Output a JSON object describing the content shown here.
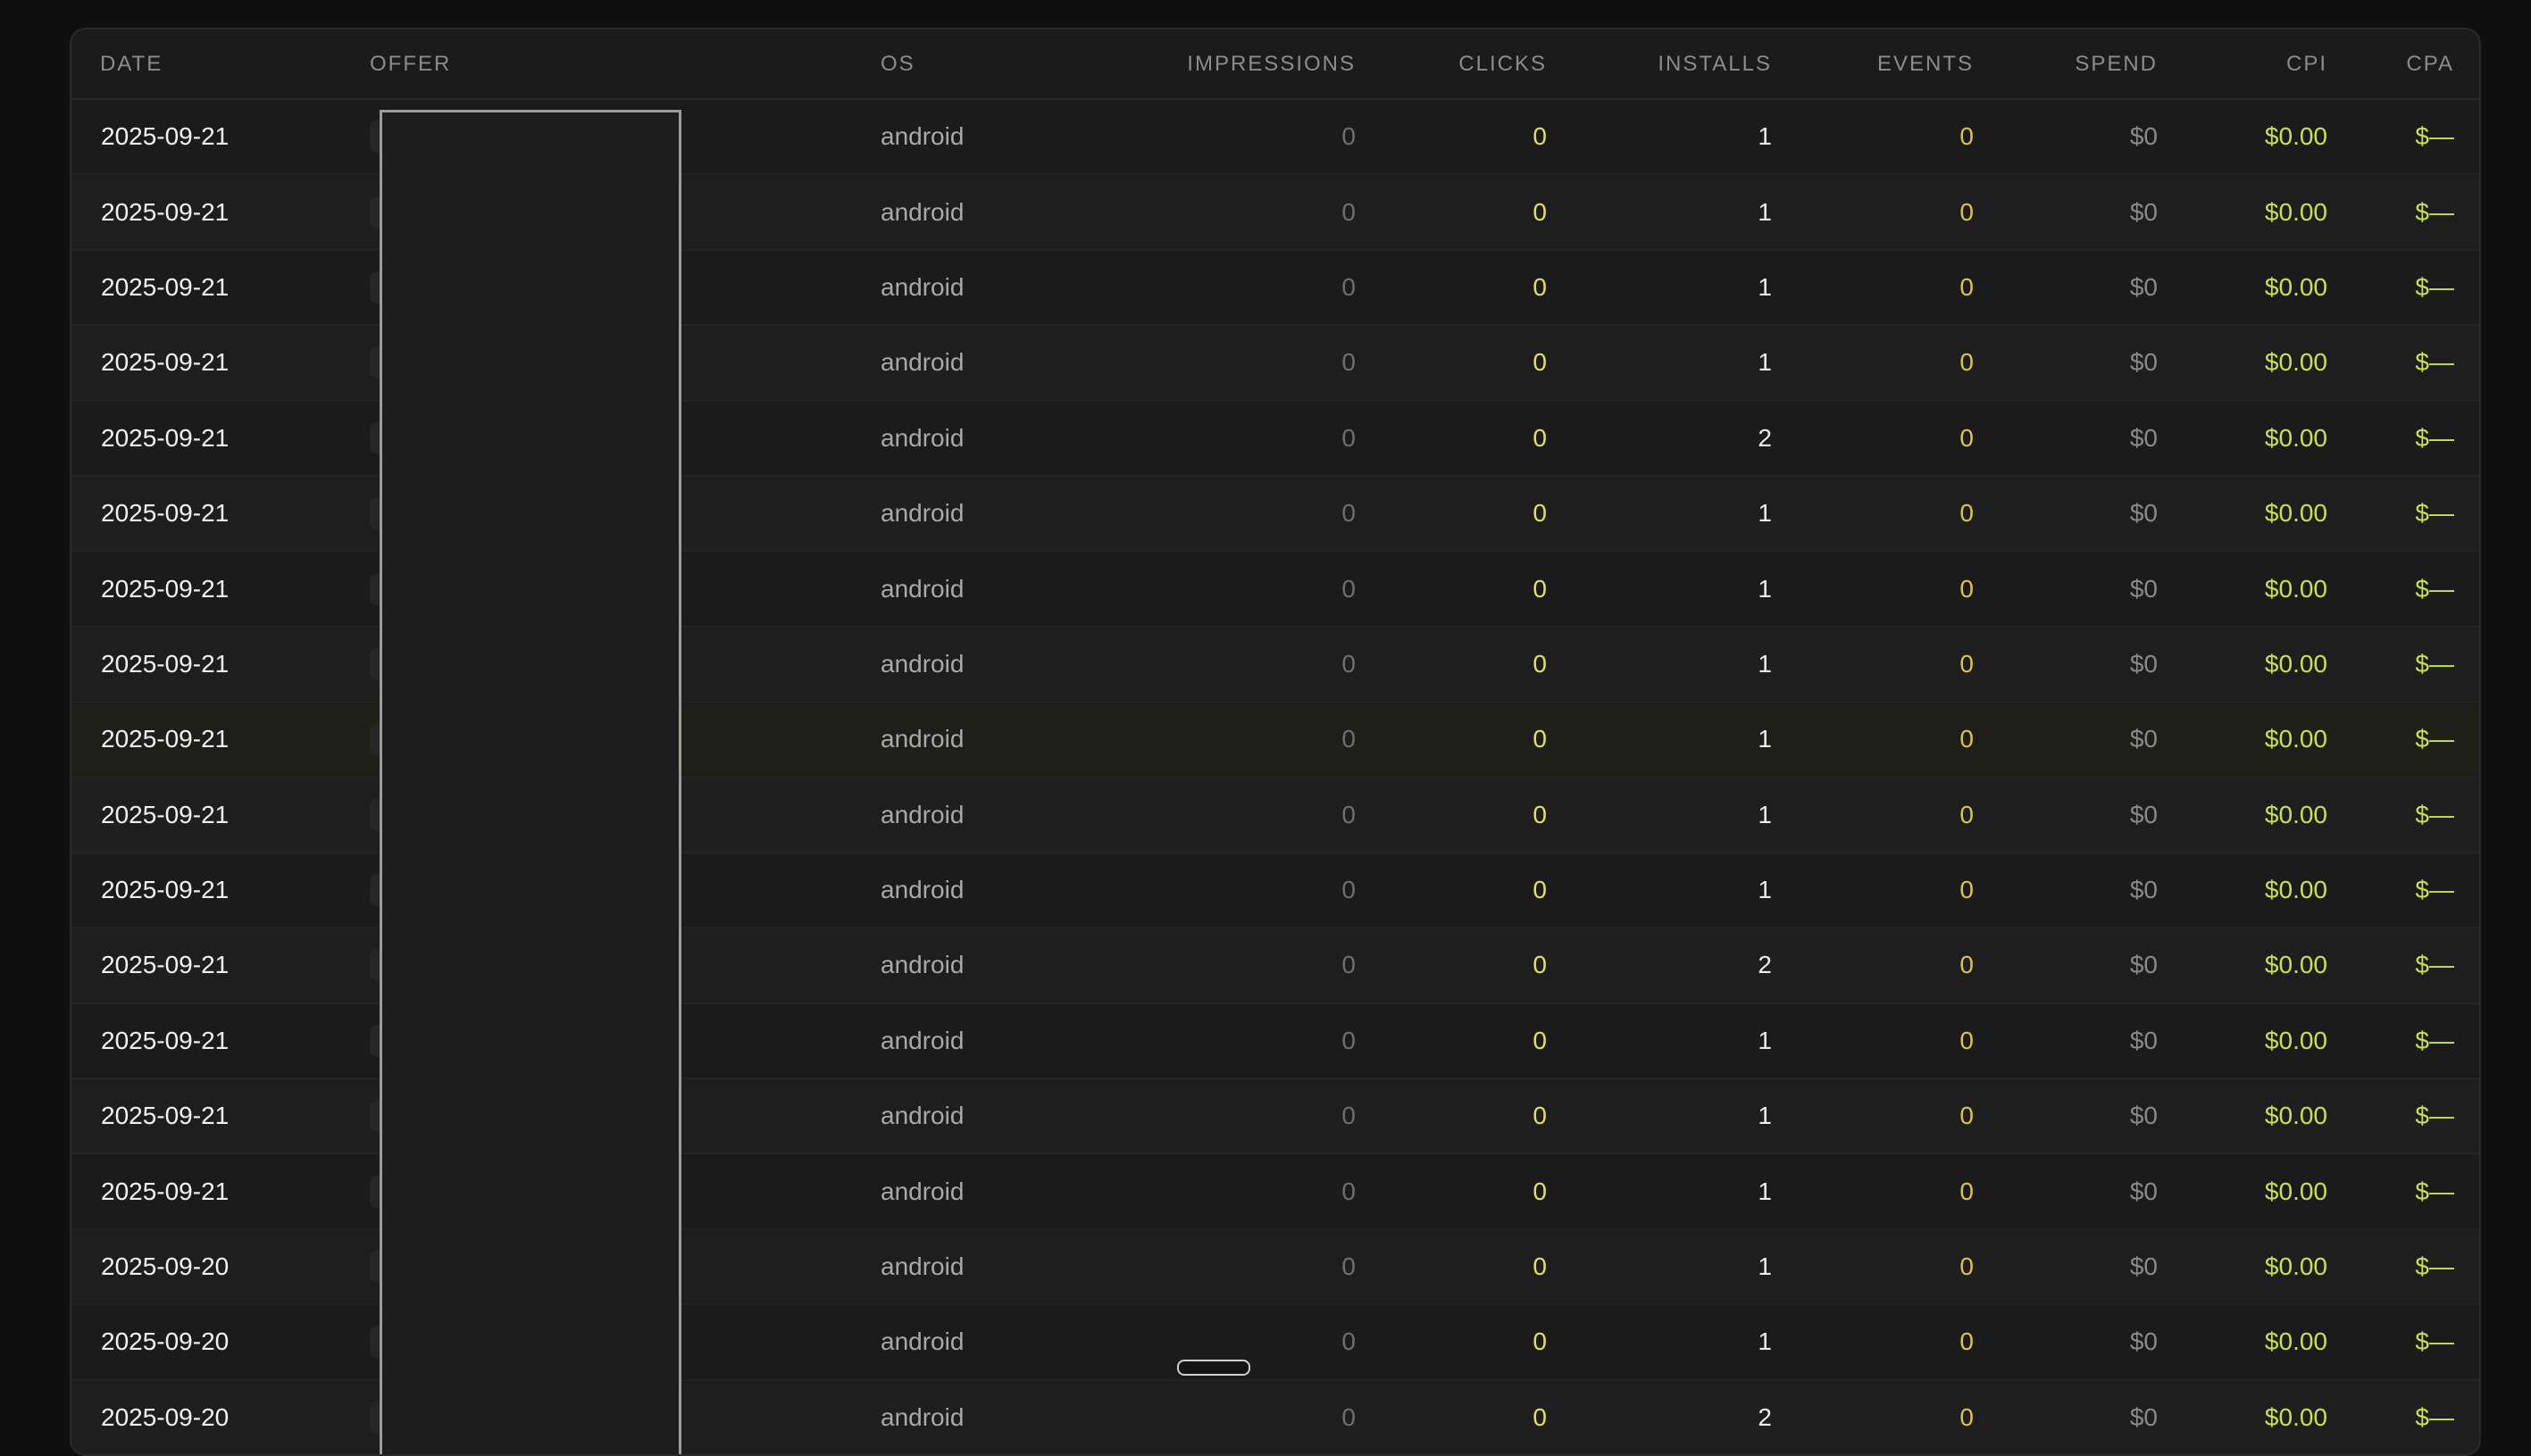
{
  "columns": {
    "date": "DATE",
    "offer": "OFFER",
    "os": "OS",
    "impressions": "IMPRESSIONS",
    "clicks": "CLICKS",
    "installs": "INSTALLS",
    "events": "EVENTS",
    "spend": "SPEND",
    "cpi": "CPI",
    "cpa": "CPA"
  },
  "rows": [
    {
      "date": "2025-09-21",
      "os": "android",
      "impressions": "0",
      "clicks": "0",
      "installs": "1",
      "events": "0",
      "spend": "$0",
      "cpi": "$0.00",
      "cpa": "$—"
    },
    {
      "date": "2025-09-21",
      "os": "android",
      "impressions": "0",
      "clicks": "0",
      "installs": "1",
      "events": "0",
      "spend": "$0",
      "cpi": "$0.00",
      "cpa": "$—"
    },
    {
      "date": "2025-09-21",
      "os": "android",
      "impressions": "0",
      "clicks": "0",
      "installs": "1",
      "events": "0",
      "spend": "$0",
      "cpi": "$0.00",
      "cpa": "$—"
    },
    {
      "date": "2025-09-21",
      "os": "android",
      "impressions": "0",
      "clicks": "0",
      "installs": "1",
      "events": "0",
      "spend": "$0",
      "cpi": "$0.00",
      "cpa": "$—"
    },
    {
      "date": "2025-09-21",
      "os": "android",
      "impressions": "0",
      "clicks": "0",
      "installs": "2",
      "events": "0",
      "spend": "$0",
      "cpi": "$0.00",
      "cpa": "$—"
    },
    {
      "date": "2025-09-21",
      "os": "android",
      "impressions": "0",
      "clicks": "0",
      "installs": "1",
      "events": "0",
      "spend": "$0",
      "cpi": "$0.00",
      "cpa": "$—"
    },
    {
      "date": "2025-09-21",
      "os": "android",
      "impressions": "0",
      "clicks": "0",
      "installs": "1",
      "events": "0",
      "spend": "$0",
      "cpi": "$0.00",
      "cpa": "$—"
    },
    {
      "date": "2025-09-21",
      "os": "android",
      "impressions": "0",
      "clicks": "0",
      "installs": "1",
      "events": "0",
      "spend": "$0",
      "cpi": "$0.00",
      "cpa": "$—"
    },
    {
      "date": "2025-09-21",
      "os": "android",
      "impressions": "0",
      "clicks": "0",
      "installs": "1",
      "events": "0",
      "spend": "$0",
      "cpi": "$0.00",
      "cpa": "$—"
    },
    {
      "date": "2025-09-21",
      "os": "android",
      "impressions": "0",
      "clicks": "0",
      "installs": "1",
      "events": "0",
      "spend": "$0",
      "cpi": "$0.00",
      "cpa": "$—"
    },
    {
      "date": "2025-09-21",
      "os": "android",
      "impressions": "0",
      "clicks": "0",
      "installs": "1",
      "events": "0",
      "spend": "$0",
      "cpi": "$0.00",
      "cpa": "$—"
    },
    {
      "date": "2025-09-21",
      "os": "android",
      "impressions": "0",
      "clicks": "0",
      "installs": "2",
      "events": "0",
      "spend": "$0",
      "cpi": "$0.00",
      "cpa": "$—"
    },
    {
      "date": "2025-09-21",
      "os": "android",
      "impressions": "0",
      "clicks": "0",
      "installs": "1",
      "events": "0",
      "spend": "$0",
      "cpi": "$0.00",
      "cpa": "$—"
    },
    {
      "date": "2025-09-21",
      "os": "android",
      "impressions": "0",
      "clicks": "0",
      "installs": "1",
      "events": "0",
      "spend": "$0",
      "cpi": "$0.00",
      "cpa": "$—"
    },
    {
      "date": "2025-09-21",
      "os": "android",
      "impressions": "0",
      "clicks": "0",
      "installs": "1",
      "events": "0",
      "spend": "$0",
      "cpi": "$0.00",
      "cpa": "$—"
    },
    {
      "date": "2025-09-20",
      "os": "android",
      "impressions": "0",
      "clicks": "0",
      "installs": "1",
      "events": "0",
      "spend": "$0",
      "cpi": "$0.00",
      "cpa": "$—"
    },
    {
      "date": "2025-09-20",
      "os": "android",
      "impressions": "0",
      "clicks": "0",
      "installs": "1",
      "events": "0",
      "spend": "$0",
      "cpi": "$0.00",
      "cpa": "$—"
    },
    {
      "date": "2025-09-20",
      "os": "android",
      "impressions": "0",
      "clicks": "0",
      "installs": "2",
      "events": "0",
      "spend": "$0",
      "cpi": "$0.00",
      "cpa": "$—"
    }
  ]
}
